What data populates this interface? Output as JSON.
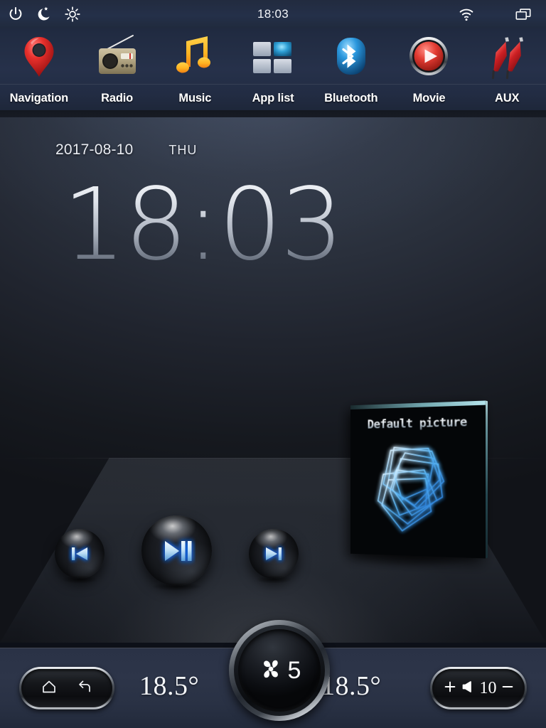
{
  "statusbar": {
    "clock": "18:03",
    "left_icons": [
      {
        "name": "power-icon"
      },
      {
        "name": "night-mode-icon"
      },
      {
        "name": "brightness-icon"
      }
    ],
    "right_icons": [
      {
        "name": "wifi-icon"
      },
      {
        "name": "recent-apps-icon"
      }
    ]
  },
  "topnav": {
    "items": [
      {
        "label": "Navigation",
        "icon": "map-pin-icon"
      },
      {
        "label": "Radio",
        "icon": "radio-icon"
      },
      {
        "label": "Music",
        "icon": "music-note-icon"
      },
      {
        "label": "App list",
        "icon": "app-grid-icon"
      },
      {
        "label": "Bluetooth",
        "icon": "bluetooth-icon"
      },
      {
        "label": "Movie",
        "icon": "play-circle-icon"
      },
      {
        "label": "AUX",
        "icon": "aux-plug-icon"
      }
    ]
  },
  "clock_widget": {
    "date": "2017-08-10",
    "weekday": "THU",
    "time": "18:03"
  },
  "album": {
    "title": "Default picture"
  },
  "transport": {
    "prev_label": "previous-track",
    "play_label": "play-pause",
    "next_label": "next-track"
  },
  "bottombar": {
    "home_icon": "home-icon",
    "back_icon": "back-arrow-icon",
    "temp_left": "18.5°",
    "temp_right": "18.5°",
    "fan_icon": "fan-icon",
    "fan_speed": "5",
    "volume_plus": "+",
    "volume_icon": "speaker-icon",
    "volume_value": "10",
    "volume_minus": "—"
  },
  "colors": {
    "statusbar_bg": "#243049",
    "topnav_bg": "#26314a",
    "stage_top": "#39404f",
    "stage_bottom": "#111318",
    "bottombar_bg": "#2d3549",
    "accent_blue": "#2f7fe0",
    "text_primary": "#ffffff"
  }
}
